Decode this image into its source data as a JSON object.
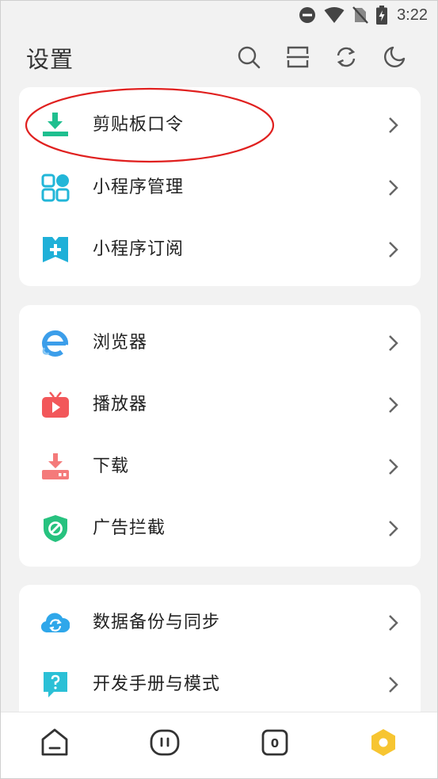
{
  "status_bar": {
    "time": "3:22",
    "icons": [
      "do-not-disturb-icon",
      "wifi-icon",
      "no-sim-icon",
      "battery-charging-icon"
    ]
  },
  "header": {
    "title": "设置",
    "actions": [
      "search-icon",
      "scan-icon",
      "refresh-icon",
      "night-mode-icon"
    ]
  },
  "groups": [
    {
      "items": [
        {
          "label": "剪贴板口令",
          "icon": "clipboard-download-icon",
          "color": "#1fbf8f"
        },
        {
          "label": "小程序管理",
          "icon": "apps-grid-icon",
          "color": "#22b6d8"
        },
        {
          "label": "小程序订阅",
          "icon": "bookmark-add-icon",
          "color": "#1fb0d8"
        }
      ]
    },
    {
      "items": [
        {
          "label": "浏览器",
          "icon": "browser-icon",
          "color": "#3c9eea"
        },
        {
          "label": "播放器",
          "icon": "tv-player-icon",
          "color": "#f2575a"
        },
        {
          "label": "下载",
          "icon": "download-icon",
          "color": "#f47a7a"
        },
        {
          "label": "广告拦截",
          "icon": "ad-block-shield-icon",
          "color": "#27c27f"
        }
      ]
    },
    {
      "items": [
        {
          "label": "数据备份与同步",
          "icon": "cloud-sync-icon",
          "color": "#2fa7ea"
        },
        {
          "label": "开发手册与模式",
          "icon": "help-bubble-icon",
          "color": "#2bc0d6"
        }
      ]
    }
  ],
  "bottom_nav": {
    "items": [
      "home-icon",
      "robot-face-icon",
      "tabs-count-icon",
      "settings-hex-icon"
    ],
    "tabs_count": "0",
    "active_color": "#f7c531"
  },
  "annotation_color": "#e0201f"
}
